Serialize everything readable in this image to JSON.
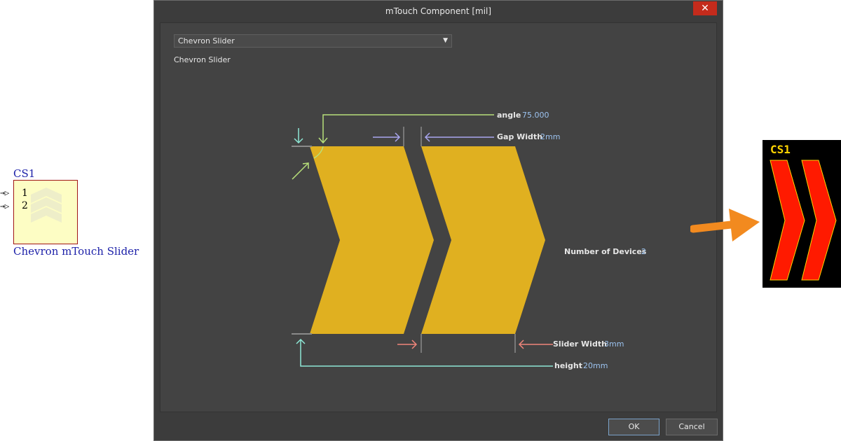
{
  "schematic": {
    "designator": "CS1",
    "pins": [
      "1",
      "2"
    ],
    "component_name": "Chevron mTouch Slider"
  },
  "dialog": {
    "title": "mTouch Component [mil]",
    "close_icon": "close-icon",
    "selector": {
      "selected": "Chevron Slider"
    },
    "description": "Chevron Slider",
    "parameters": {
      "angle": {
        "label": "angle",
        "value": "75.000"
      },
      "gap_width": {
        "label": "Gap Width",
        "value": "2mm"
      },
      "number_of_devices": {
        "label": "Number of Devices",
        "value": "2"
      },
      "slider_width": {
        "label": "Slider Width",
        "value": "3mm"
      },
      "height": {
        "label": "height",
        "value": "20mm"
      }
    },
    "buttons": {
      "ok": "OK",
      "cancel": "Cancel"
    }
  },
  "pcb": {
    "designator": "CS1"
  },
  "colors": {
    "chevron": "#e0b020",
    "angle_line": "#b8e07a",
    "gap_line": "#a9a6f0",
    "slider_width_line": "#f0857a",
    "height_line": "#8ee8d6",
    "pcb_pad": "#ff1a00",
    "pcb_outline": "#ffd400",
    "arrow": "#f28a1f"
  }
}
